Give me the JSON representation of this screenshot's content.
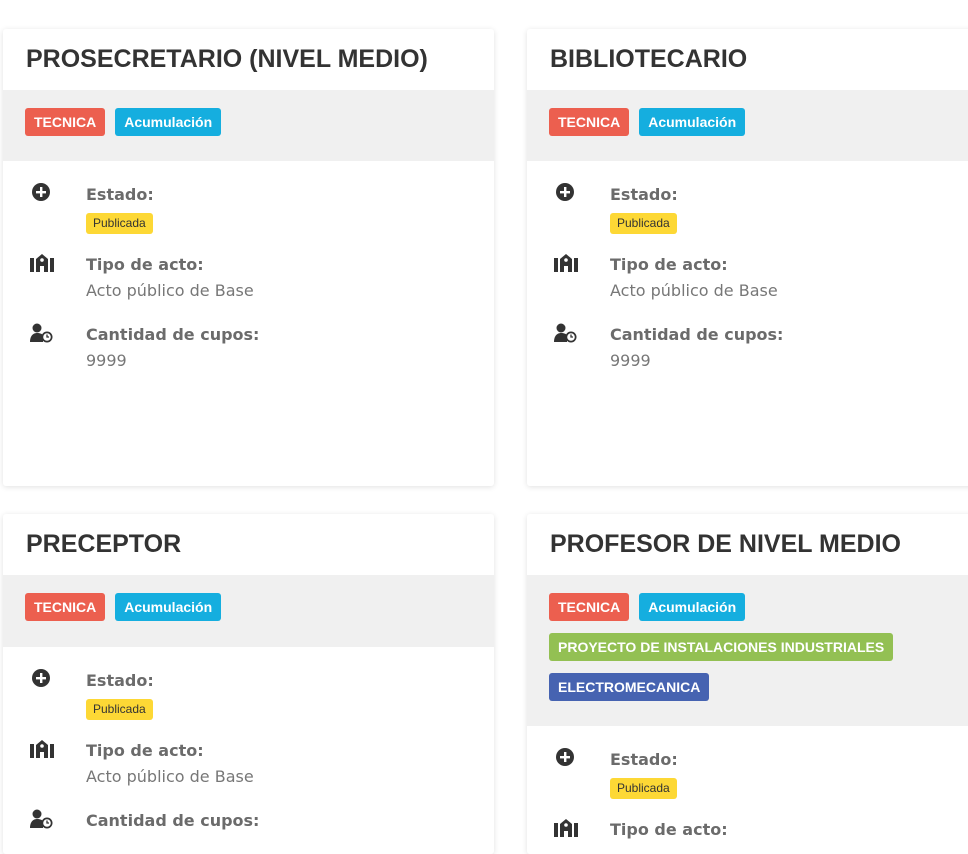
{
  "colors": {
    "tecnica": "#ec5f4f",
    "acumulacion": "#15aedf",
    "proyecto": "#93c053",
    "electromecanica": "#4663b1",
    "publicada": "#fdd835"
  },
  "cards": [
    {
      "title": "PROSECRETARIO (NIVEL MEDIO)",
      "tags": [
        "TECNICA",
        "Acumulación"
      ],
      "estado_label": "Estado:",
      "estado_value": "Publicada",
      "tipo_label": "Tipo de acto:",
      "tipo_value": "Acto público de Base",
      "cupos_label": "Cantidad de cupos:",
      "cupos_value": "9999"
    },
    {
      "title": "BIBLIOTECARIO",
      "tags": [
        "TECNICA",
        "Acumulación"
      ],
      "estado_label": "Estado:",
      "estado_value": "Publicada",
      "tipo_label": "Tipo de acto:",
      "tipo_value": "Acto público de Base",
      "cupos_label": "Cantidad de cupos:",
      "cupos_value": "9999"
    },
    {
      "title": "PRECEPTOR",
      "tags": [
        "TECNICA",
        "Acumulación"
      ],
      "estado_label": "Estado:",
      "estado_value": "Publicada",
      "tipo_label": "Tipo de acto:",
      "tipo_value": "Acto público de Base",
      "cupos_label": "Cantidad de cupos:"
    },
    {
      "title": "PROFESOR DE NIVEL MEDIO",
      "tags": [
        "TECNICA",
        "Acumulación"
      ],
      "tags2": [
        "PROYECTO DE INSTALACIONES INDUSTRIALES"
      ],
      "tags3": [
        "ELECTROMECANICA"
      ],
      "estado_label": "Estado:",
      "estado_value": "Publicada",
      "tipo_label": "Tipo de acto:"
    }
  ]
}
